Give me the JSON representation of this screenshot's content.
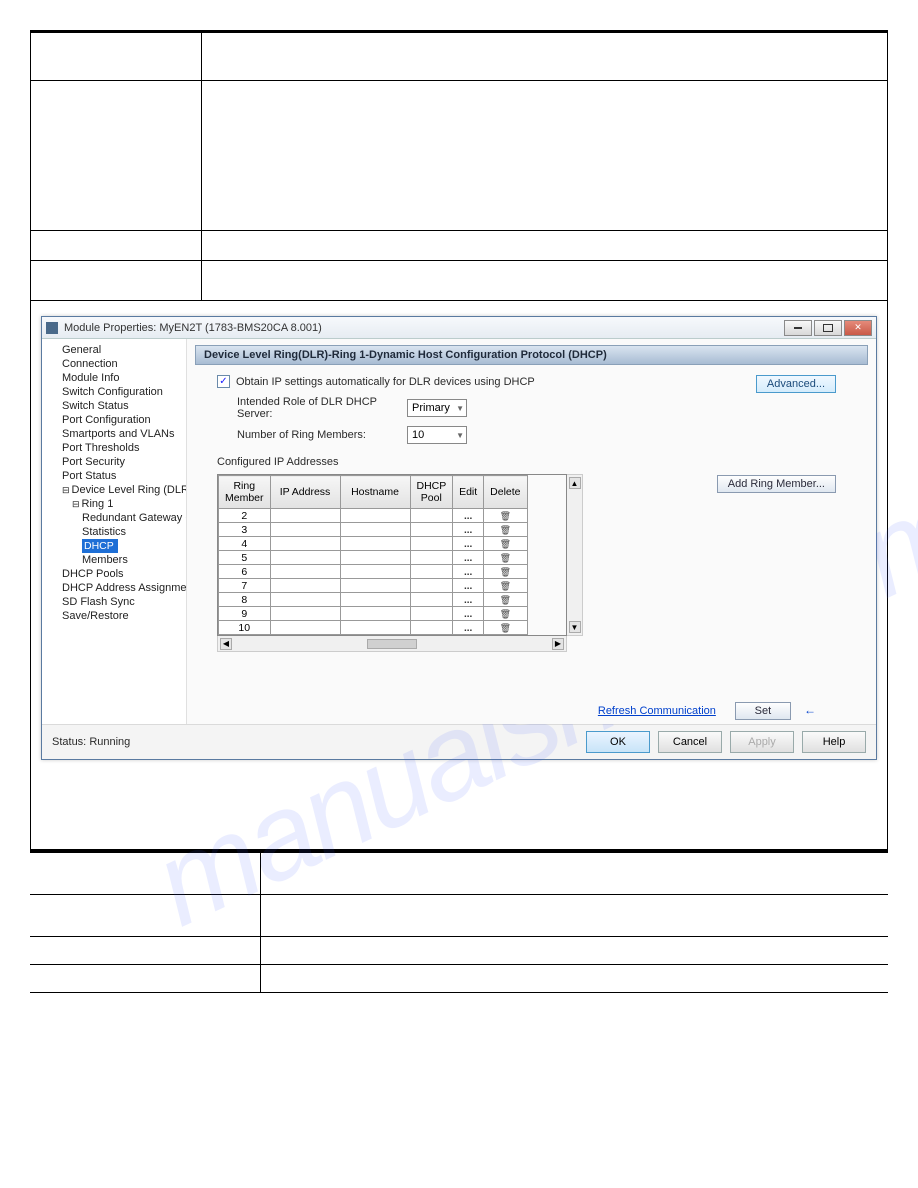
{
  "window": {
    "title": "Module Properties: MyEN2T (1783-BMS20CA 8.001)"
  },
  "tree": {
    "items": [
      {
        "label": "General",
        "lv": 1
      },
      {
        "label": "Connection",
        "lv": 1
      },
      {
        "label": "Module Info",
        "lv": 1
      },
      {
        "label": "Switch Configuration",
        "lv": 1
      },
      {
        "label": "Switch Status",
        "lv": 1
      },
      {
        "label": "Port Configuration",
        "lv": 1
      },
      {
        "label": "Smartports and VLANs",
        "lv": 1
      },
      {
        "label": "Port Thresholds",
        "lv": 1
      },
      {
        "label": "Port Security",
        "lv": 1
      },
      {
        "label": "Port Status",
        "lv": 1
      },
      {
        "label": "Device Level Ring (DLR)",
        "lv": 1,
        "exp": "−"
      },
      {
        "label": "Ring 1",
        "lv": 2,
        "exp": "−"
      },
      {
        "label": "Redundant Gateway C",
        "lv": 3
      },
      {
        "label": "Statistics",
        "lv": 3
      },
      {
        "label": "DHCP",
        "lv": 3,
        "sel": true
      },
      {
        "label": "Members",
        "lv": 3
      },
      {
        "label": "DHCP Pools",
        "lv": 1
      },
      {
        "label": "DHCP Address Assignment",
        "lv": 1
      },
      {
        "label": "SD Flash Sync",
        "lv": 1
      },
      {
        "label": "Save/Restore",
        "lv": 1
      }
    ]
  },
  "panel": {
    "header": "Device Level Ring(DLR)-Ring 1-Dynamic Host Configuration Protocol (DHCP)",
    "obtain_checkbox_label": "Obtain IP settings automatically for DLR devices using DHCP",
    "obtain_checked": "✓",
    "advanced_btn": "Advanced...",
    "intended_role_label": "Intended Role of DLR DHCP Server:",
    "intended_role_value": "Primary",
    "num_members_label": "Number of Ring Members:",
    "num_members_value": "10",
    "configured_label": "Configured IP Addresses",
    "add_ring_btn": "Add Ring Member...",
    "grid": {
      "cols": [
        "Ring Member",
        "IP Address",
        "Hostname",
        "DHCP Pool",
        "Edit",
        "Delete"
      ],
      "rows": [
        "2",
        "3",
        "4",
        "5",
        "6",
        "7",
        "8",
        "9",
        "10"
      ]
    },
    "refresh_link": "Refresh Communication",
    "set_btn": "Set"
  },
  "status": {
    "label": "Status:",
    "value": "Running"
  },
  "buttons": {
    "ok": "OK",
    "cancel": "Cancel",
    "apply": "Apply",
    "help": "Help"
  }
}
